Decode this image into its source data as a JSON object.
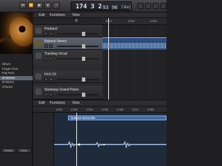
{
  "transport": {
    "position": "174",
    "sub": "3 2",
    "tempo": "93",
    "signature": "96",
    "key": "Cmaj",
    "buttons": [
      "⏮",
      "⏪",
      "▶",
      "⏹",
      "●"
    ]
  },
  "library": {
    "items": [
      "Strum",
      "Finger Pick",
      "Flat Pick",
      "al Stereo",
      "al Strum",
      "Chorus"
    ],
    "selected_index": 3,
    "bottom_buttons": [
      "Delete",
      "Save"
    ]
  },
  "tracks_menu": {
    "edit": "Edit",
    "functions": "Functions",
    "view": "View"
  },
  "ruler": {
    "ticks": [
      "1617",
      "1733",
      "1749"
    ]
  },
  "tracks": [
    {
      "name": "Portland",
      "selected": false
    },
    {
      "name": "Natural Stereo",
      "selected": true
    },
    {
      "name": "Tracking Vocal",
      "selected": false
    },
    {
      "name": "Hi-Fi DI",
      "selected": false
    },
    {
      "name": "Steinway Grand Piano",
      "selected": false
    }
  ],
  "editor_menu": {
    "edit": "Edit",
    "functions": "Functions",
    "view": "View"
  },
  "editor_ruler": {
    "ticks": [
      "1732",
      "1733",
      "1734",
      "1735",
      "1736",
      "1737",
      "1738"
    ]
  },
  "editor": {
    "region_name": "Natural Stereofile"
  },
  "colors": {
    "region": "#2c4c7a",
    "selection": "#5f6672",
    "record": "#e23a2a"
  }
}
